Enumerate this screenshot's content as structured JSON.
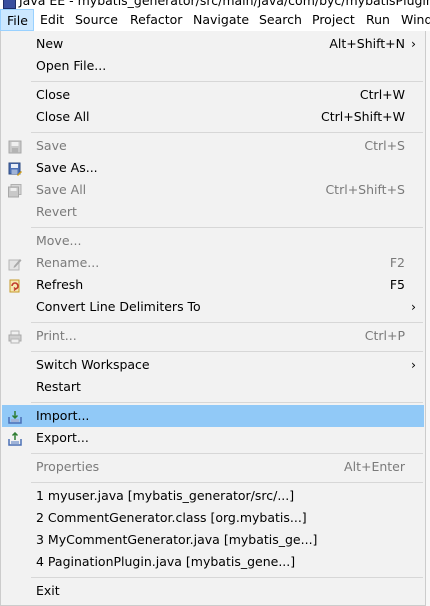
{
  "window": {
    "title": "Java EE - mybatis_generator/src/main/java/com/byc/mybatisPlugin/My"
  },
  "menubar": {
    "items": [
      "File",
      "Edit",
      "Source",
      "Refactor",
      "Navigate",
      "Search",
      "Project",
      "Run",
      "Wind"
    ]
  },
  "file_menu": {
    "new": {
      "label": "New",
      "accel": "Alt+Shift+N",
      "arrow": "›"
    },
    "open_file": {
      "label": "Open File..."
    },
    "close": {
      "label": "Close",
      "accel": "Ctrl+W"
    },
    "close_all": {
      "label": "Close All",
      "accel": "Ctrl+Shift+W"
    },
    "save": {
      "label": "Save",
      "accel": "Ctrl+S"
    },
    "save_as": {
      "label": "Save As..."
    },
    "save_all": {
      "label": "Save All",
      "accel": "Ctrl+Shift+S"
    },
    "revert": {
      "label": "Revert"
    },
    "move": {
      "label": "Move..."
    },
    "rename": {
      "label": "Rename...",
      "accel": "F2"
    },
    "refresh": {
      "label": "Refresh",
      "accel": "F5"
    },
    "convert": {
      "label": "Convert Line Delimiters To",
      "arrow": "›"
    },
    "print": {
      "label": "Print...",
      "accel": "Ctrl+P"
    },
    "switch_ws": {
      "label": "Switch Workspace",
      "arrow": "›"
    },
    "restart": {
      "label": "Restart"
    },
    "import": {
      "label": "Import..."
    },
    "export": {
      "label": "Export..."
    },
    "properties": {
      "label": "Properties",
      "accel": "Alt+Enter"
    },
    "recent": [
      "1 myuser.java  [mybatis_generator/src/...]",
      "2 CommentGenerator.class  [org.mybatis...]",
      "3 MyCommentGenerator.java  [mybatis_ge...]",
      "4 PaginationPlugin.java  [mybatis_gene...]"
    ],
    "exit": {
      "label": "Exit"
    }
  },
  "colors": {
    "highlight": "#91c9f7",
    "menu_bg": "#f2f2f2",
    "active_menu": "#cce8ff"
  }
}
